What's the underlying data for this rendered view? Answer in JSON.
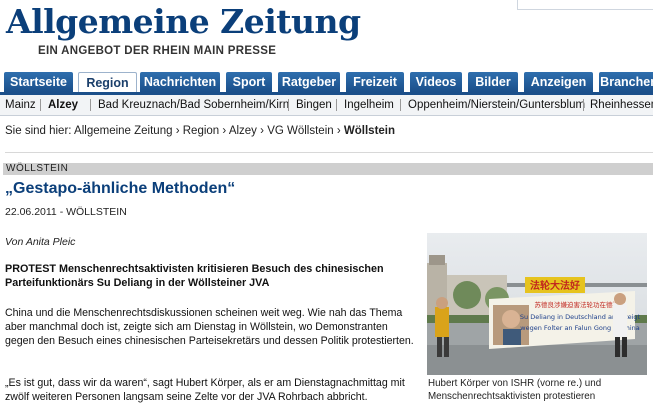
{
  "masthead": {
    "logo": "Allgemeine Zeitung",
    "tagline": "EIN ANGEBOT DER RHEIN MAIN PRESSE"
  },
  "tabs": [
    {
      "label": "Startseite"
    },
    {
      "label": "Region"
    },
    {
      "label": "Nachrichten"
    },
    {
      "label": "Sport"
    },
    {
      "label": "Ratgeber"
    },
    {
      "label": "Freizeit"
    },
    {
      "label": "Videos"
    },
    {
      "label": "Bilder"
    },
    {
      "label": "Anzeigen"
    },
    {
      "label": "Branchen"
    }
  ],
  "subnav": [
    {
      "label": "Mainz"
    },
    {
      "label": "Alzey"
    },
    {
      "label": "Bad Kreuznach/Bad Sobernheim/Kirn"
    },
    {
      "label": "Bingen"
    },
    {
      "label": "Ingelheim"
    },
    {
      "label": "Oppenheim/Nierstein/Guntersblum"
    },
    {
      "label": "Rheinhessen"
    }
  ],
  "breadcrumb": {
    "prefix": "Sie sind hier:",
    "items": [
      "Allgemeine Zeitung",
      "Region",
      "Alzey",
      "VG Wöllstein"
    ],
    "current": "Wöllstein",
    "separator": "›"
  },
  "article": {
    "section": "WÖLLSTEIN",
    "headline": "„Gestapo-ähnliche Methoden“",
    "dateline": "22.06.2011 - WÖLLSTEIN",
    "author": "Von Anita Pleic",
    "lead": "PROTEST Menschenrechtsaktivisten kritisieren Besuch des chinesischen Parteifunktionärs Su Deliang in der Wöllsteiner JVA",
    "paragraphs": [
      "China und die Menschenrechtsdiskussionen scheinen weit weg. Wie nah das Thema aber manchmal doch ist, zeigte sich am Dienstag in Wöllstein, wo Demonstranten gegen den Besuch eines chinesischen Parteisekretärs und dessen Politik protestierten.",
      "„Es ist gut, dass wir da waren“, sagt Hubert Körper, als er am Dienstagnachmittag mit zwölf weiteren Personen langsam seine Zelte vor der JVA Rohrbach abbricht."
    ],
    "photo_caption": "Hubert Körper von ISHR (vorne re.) und Menschenrechtsaktivisten protestieren",
    "banner_top": "法轮大法好",
    "banner_line1": "苏德良涉嫌迫害法轮功在德被告",
    "banner_line2": "Su Deliang in Deutschland angezeigt",
    "banner_line3": "wegen Folter an Falun Gong in China"
  },
  "colors": {
    "brand_blue": "#0b3f7a",
    "tab_blue": "#1b4f8a"
  }
}
